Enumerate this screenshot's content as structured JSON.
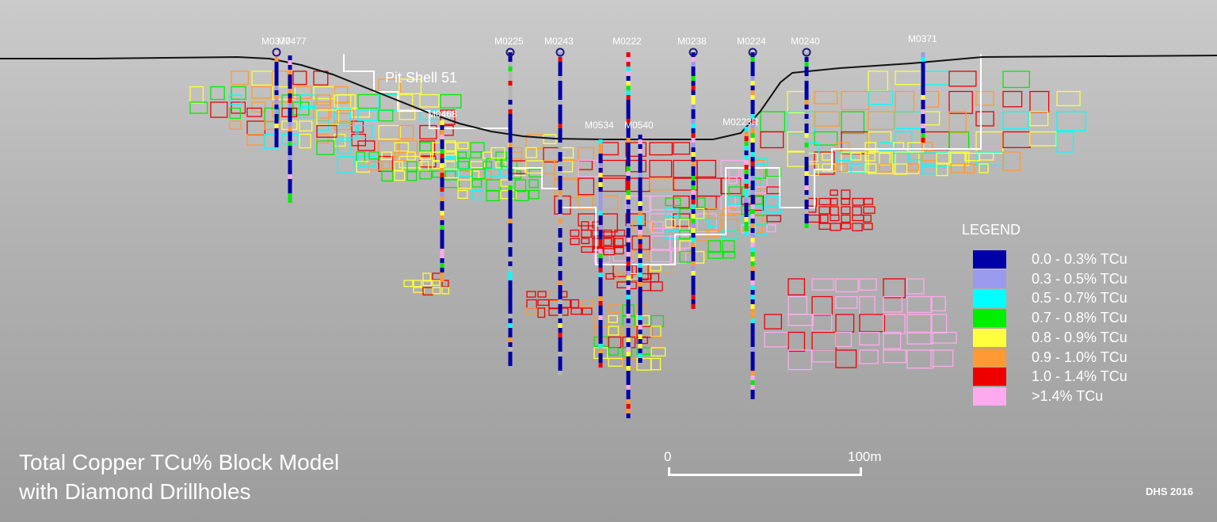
{
  "title": {
    "line1": "Total Copper TCu% Block Model",
    "line2": "with Diamond Drillholes"
  },
  "credit": "DHS 2016",
  "pit_label": "Pit Shell 51",
  "scale": {
    "start": "0",
    "end": "100m"
  },
  "legend": {
    "title": "LEGEND",
    "items": [
      {
        "label": "0.0 - 0.3% TCu",
        "color": "#0000a8"
      },
      {
        "label": "0.3 - 0.5% TCu",
        "color": "#9a9aee"
      },
      {
        "label": "0.5 - 0.7% TCu",
        "color": "#00ffff"
      },
      {
        "label": "0.7 - 0.8% TCu",
        "color": "#00ee00"
      },
      {
        "label": "0.8 - 0.9% TCu",
        "color": "#ffff3c"
      },
      {
        "label": "0.9 - 1.0% TCu",
        "color": "#ff9933"
      },
      {
        "label": "1.0 - 1.4% TCu",
        "color": "#ee0000"
      },
      {
        "label": ">1.4% TCu",
        "color": "#ffaaee"
      }
    ]
  },
  "drillholes": [
    {
      "name": "M0377"
    },
    {
      "name": "M0477"
    },
    {
      "name": "M0225"
    },
    {
      "name": "M0243"
    },
    {
      "name": "M0222"
    },
    {
      "name": "M0238"
    },
    {
      "name": "M0224"
    },
    {
      "name": "M0240"
    },
    {
      "name": "M0371"
    },
    {
      "name": "M0468"
    },
    {
      "name": "M0534"
    },
    {
      "name": "M0540"
    },
    {
      "name": "M0223R"
    }
  ]
}
